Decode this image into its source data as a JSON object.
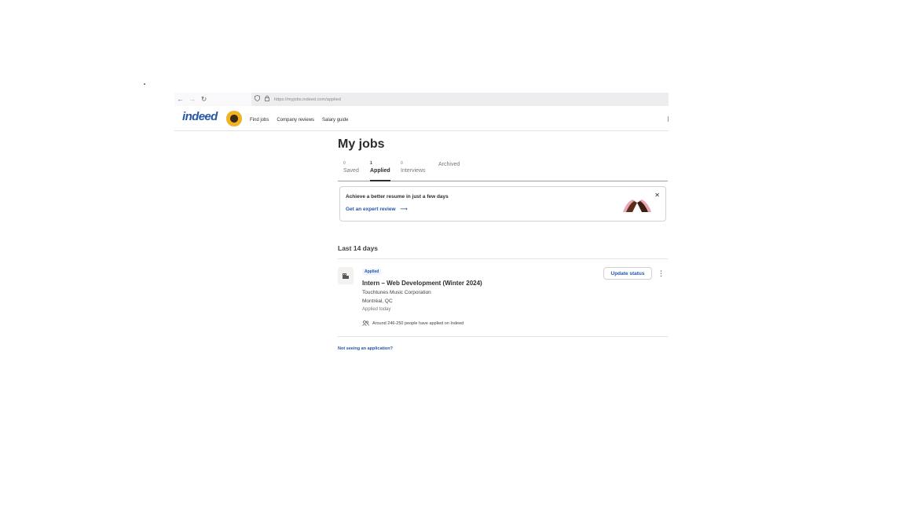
{
  "browser": {
    "back_icon": "arrow-left-icon",
    "forward_icon": "arrow-right-icon",
    "reload_icon": "reload-icon",
    "url": "https://myjobs.indeed.com/applied"
  },
  "header": {
    "logo": "indeed",
    "nav": [
      "Find jobs",
      "Company reviews",
      "Salary guide"
    ]
  },
  "main": {
    "title": "My jobs",
    "tabs": [
      {
        "count": "0",
        "label": "Saved",
        "active": false
      },
      {
        "count": "1",
        "label": "Applied",
        "active": true
      },
      {
        "count": "0",
        "label": "Interviews",
        "active": false
      },
      {
        "count": "",
        "label": "Archived",
        "active": false
      }
    ],
    "promo": {
      "title": "Achieve a better resume in just a few days",
      "link": "Get an expert review"
    },
    "section_heading": "Last 14 days",
    "job": {
      "status": "Applied",
      "title": "Intern – Web Development (Winter 2024)",
      "company": "Touchtunes Music Corporation",
      "location": "Montréal, QC",
      "applied": "Applied today",
      "applicants": "Around 246-250 people have applied on Indeed",
      "update_button": "Update status"
    },
    "help_link": "Not seeing an application?"
  },
  "colors": {
    "brand": "#2557a7",
    "text": "#2d2d2d",
    "muted": "#767676"
  }
}
